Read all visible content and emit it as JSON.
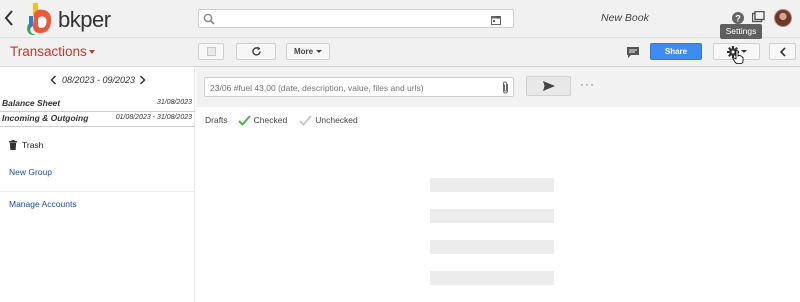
{
  "header": {
    "logo_text": "bkper",
    "search": {
      "value": "",
      "placeholder": ""
    },
    "book_name": "New Book",
    "tooltip": "Settings"
  },
  "toolbar": {
    "title": "Transactions",
    "more_label": "More",
    "share_label": "Share"
  },
  "sidebar": {
    "period": "08/2023 - 09/2023",
    "groups": [
      {
        "label": "Balance Sheet",
        "date": "31/08/2023"
      },
      {
        "label": "Incoming & Outgoing",
        "date": "01/08/2023 - 31/08/2023"
      }
    ],
    "trash_label": "Trash",
    "new_group_label": "New Group",
    "manage_accounts_label": "Manage Accounts"
  },
  "entry": {
    "placeholder": "23/06 #fuel 43,00 (date, description, value, files and urls)"
  },
  "filters": {
    "drafts": "Drafts",
    "checked": "Checked",
    "unchecked": "Unchecked"
  },
  "colors": {
    "accent_red": "#c0392b",
    "share_blue": "#3f8cf0",
    "link_blue": "#1a4fa0",
    "checked_green": "#4caf50"
  },
  "icons": {
    "back": "chevron-left-icon",
    "search": "search-icon",
    "calendar": "calendar-icon",
    "help": "help-icon",
    "apps": "apps-icon",
    "refresh": "refresh-icon",
    "comment": "comment-icon",
    "settings": "gear-icon",
    "collapse": "chevron-left-icon",
    "trash": "trash-icon",
    "attach": "paperclip-icon",
    "send": "send-icon"
  }
}
